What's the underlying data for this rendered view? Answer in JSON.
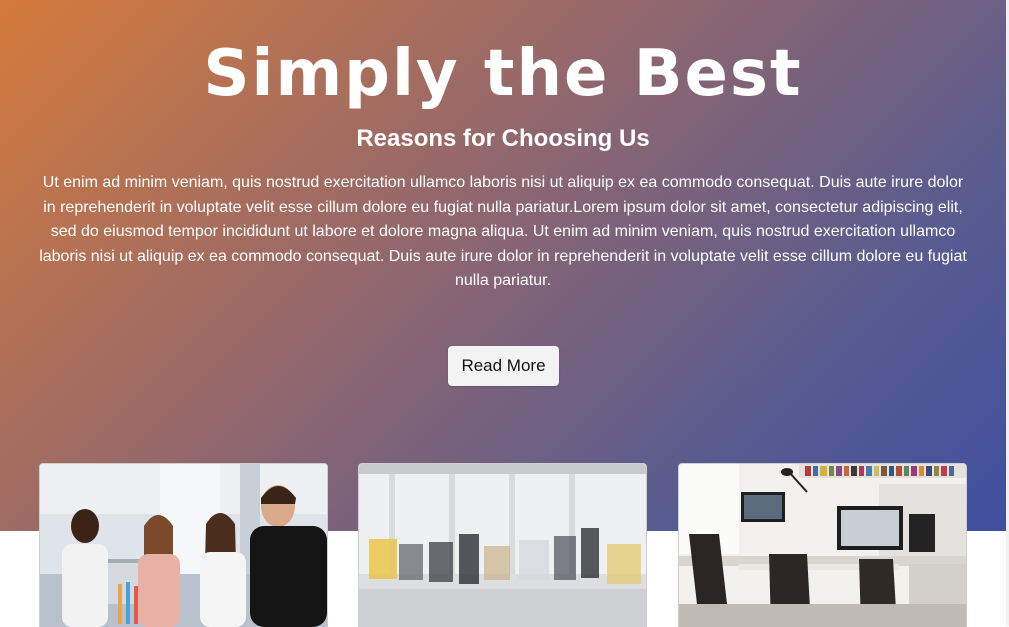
{
  "hero": {
    "title": "Simply the Best",
    "subtitle": "Reasons for Choosing Us",
    "body": "Ut enim ad minim veniam, quis nostrud exercitation ullamco laboris nisi ut aliquip ex ea commodo consequat. Duis aute irure dolor in reprehenderit in voluptate velit esse cillum dolore eu fugiat nulla pariatur.Lorem ipsum dolor sit amet, consectetur adipiscing elit, sed do eiusmod tempor incididunt ut labore et dolore magna aliqua. Ut enim ad minim veniam, quis nostrud exercitation ullamco laboris nisi ut aliquip ex ea commodo consequat. Duis aute irure dolor in reprehenderit in voluptate velit esse cillum dolore eu fugiat nulla pariatur.",
    "button_label": "Read More",
    "gradient_start": "#d57b3b",
    "gradient_end": "#3f4fa0"
  },
  "cards": [
    {
      "image": "team-photo"
    },
    {
      "image": "office-meeting-blurred"
    },
    {
      "image": "office-workspace"
    }
  ]
}
